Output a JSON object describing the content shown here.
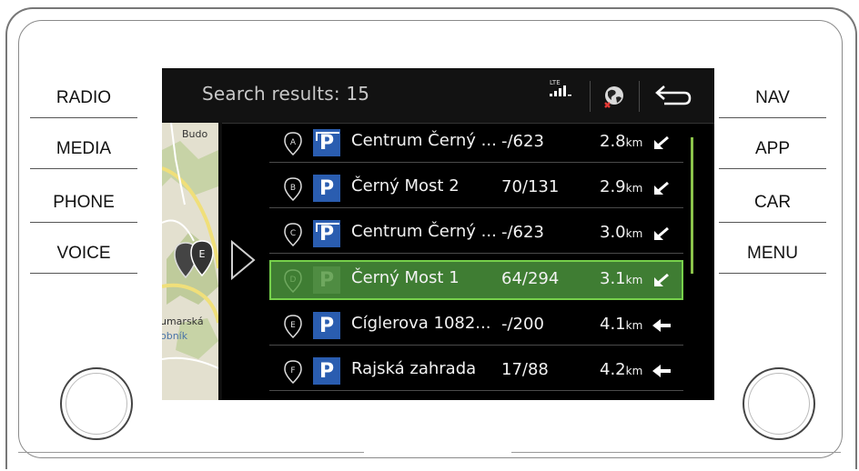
{
  "hardware_buttons": {
    "left": [
      "RADIO",
      "MEDIA",
      "PHONE",
      "VOICE"
    ],
    "right": [
      "NAV",
      "APP",
      "CAR",
      "MENU"
    ]
  },
  "header": {
    "title": "Search results: 15",
    "signal_label": "LTE",
    "icons": [
      "signal-icon",
      "globe-offline-icon",
      "back-icon"
    ]
  },
  "map": {
    "labels": [
      "Budo",
      "umarská",
      "obník"
    ],
    "marker": "E"
  },
  "results": [
    {
      "letter": "A",
      "name": "Centrum Černý ...",
      "spaces": "-/623",
      "distance": "2.8",
      "unit": "km",
      "direction": "arrow-down-left-icon",
      "covered": true,
      "selected": false
    },
    {
      "letter": "B",
      "name": "Černý Most 2",
      "spaces": "70/131",
      "distance": "2.9",
      "unit": "km",
      "direction": "arrow-down-left-icon",
      "covered": false,
      "selected": false
    },
    {
      "letter": "C",
      "name": "Centrum Černý ...",
      "spaces": "-/623",
      "distance": "3.0",
      "unit": "km",
      "direction": "arrow-down-left-icon",
      "covered": true,
      "selected": false
    },
    {
      "letter": "D",
      "name": "Černý Most 1",
      "spaces": "64/294",
      "distance": "3.1",
      "unit": "km",
      "direction": "arrow-down-left-icon",
      "covered": false,
      "selected": true
    },
    {
      "letter": "E",
      "name": "Cíglerova 1082...",
      "spaces": "-/200",
      "distance": "4.1",
      "unit": "km",
      "direction": "arrow-left-icon",
      "covered": false,
      "selected": false
    },
    {
      "letter": "F",
      "name": "Rajská zahrada",
      "spaces": "17/88",
      "distance": "4.2",
      "unit": "km",
      "direction": "arrow-left-icon",
      "covered": false,
      "selected": false
    }
  ],
  "colors": {
    "selected_row": "#3f7d33",
    "selected_border": "#76d04b",
    "parking_blue": "#2a5db0",
    "scrollbar": "#8bc34a"
  }
}
